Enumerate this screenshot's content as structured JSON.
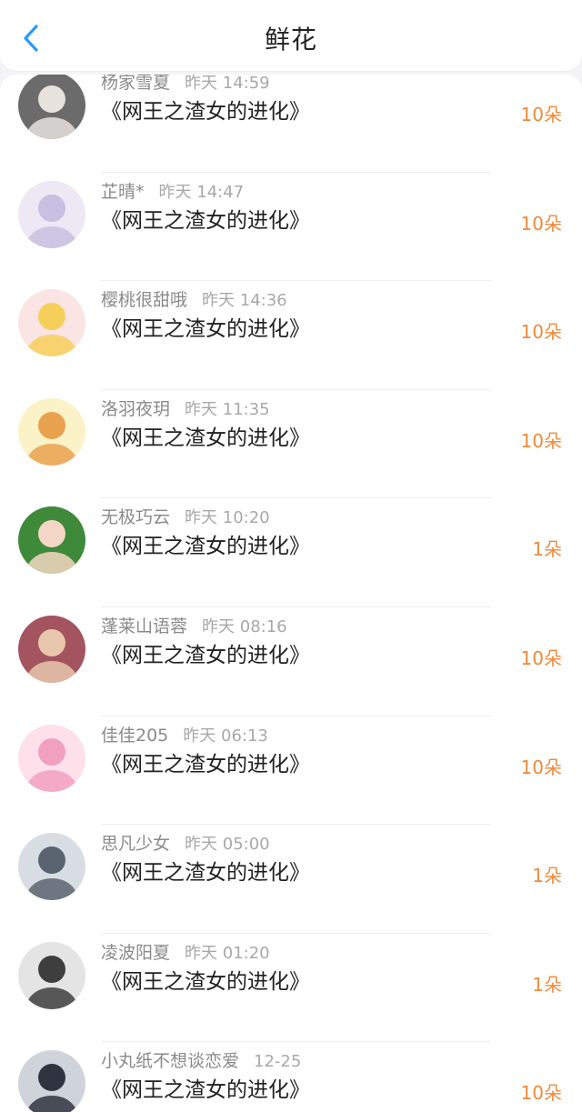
{
  "header": {
    "title": "鲜花"
  },
  "items": [
    {
      "name": "杨家雪夏",
      "time": "昨天 14:59",
      "book": "《网王之渣女的进化》",
      "count": "10朵",
      "avatar_bg": "#6b6b6b",
      "avatar_fg": "#e8e2dc"
    },
    {
      "name": "芷晴*",
      "time": "昨天 14:47",
      "book": "《网王之渣女的进化》",
      "count": "10朵",
      "avatar_bg": "#ede8f3",
      "avatar_fg": "#c9bfe0"
    },
    {
      "name": "樱桃很甜哦",
      "time": "昨天 14:36",
      "book": "《网王之渣女的进化》",
      "count": "10朵",
      "avatar_bg": "#fbe4e4",
      "avatar_fg": "#f6cf5a"
    },
    {
      "name": "洛羽夜玥",
      "time": "昨天 11:35",
      "book": "《网王之渣女的进化》",
      "count": "10朵",
      "avatar_bg": "#fbf2c8",
      "avatar_fg": "#e9a24d"
    },
    {
      "name": "无极巧云",
      "time": "昨天 10:20",
      "book": "《网王之渣女的进化》",
      "count": "1朵",
      "avatar_bg": "#3f8a3a",
      "avatar_fg": "#f3d6c3"
    },
    {
      "name": "蓬莱山语蓉",
      "time": "昨天 08:16",
      "book": "《网王之渣女的进化》",
      "count": "10朵",
      "avatar_bg": "#a3545f",
      "avatar_fg": "#e9c7ad"
    },
    {
      "name": "佳佳205",
      "time": "昨天 06:13",
      "book": "《网王之渣女的进化》",
      "count": "10朵",
      "avatar_bg": "#fde0ea",
      "avatar_fg": "#f2a0c0"
    },
    {
      "name": "思凡少女",
      "time": "昨天 05:00",
      "book": "《网王之渣女的进化》",
      "count": "1朵",
      "avatar_bg": "#d7dde3",
      "avatar_fg": "#5a6470"
    },
    {
      "name": "凌波阳夏",
      "time": "昨天 01:20",
      "book": "《网王之渣女的进化》",
      "count": "1朵",
      "avatar_bg": "#e4e4e4",
      "avatar_fg": "#3e3e3e"
    },
    {
      "name": "小丸纸不想谈恋爱",
      "time": "12-25",
      "book": "《网王之渣女的进化》",
      "count": "10朵",
      "avatar_bg": "#cfd3da",
      "avatar_fg": "#2f3440"
    }
  ],
  "colors": {
    "accent_blue": "#2b9bf4",
    "count_orange": "#ee8a3a"
  },
  "icons": {
    "back": "chevron-left-icon"
  }
}
